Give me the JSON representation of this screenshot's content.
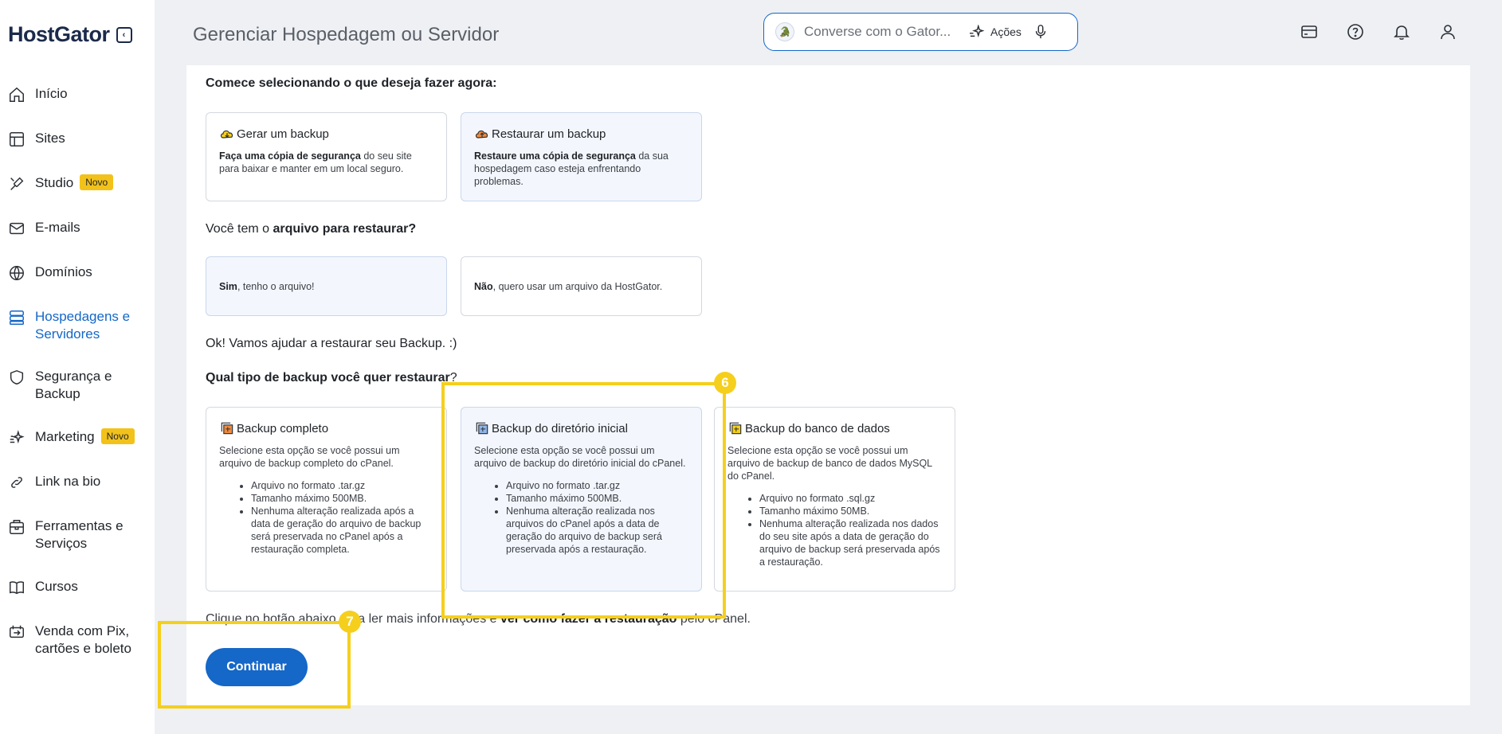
{
  "app": {
    "logo": "HostGator"
  },
  "sidebar": {
    "items": [
      {
        "label": "Início",
        "icon": "home-icon"
      },
      {
        "label": "Sites",
        "icon": "layout-icon"
      },
      {
        "label": "Studio",
        "icon": "brush-icon",
        "badge": "Novo"
      },
      {
        "label": "E-mails",
        "icon": "mail-icon"
      },
      {
        "label": "Domínios",
        "icon": "globe-icon"
      },
      {
        "label": "Hospedagens e Servidores",
        "icon": "server-icon",
        "active": true
      },
      {
        "label": "Segurança e Backup",
        "icon": "shield-icon"
      },
      {
        "label": "Marketing",
        "icon": "sparkle-icon",
        "badge": "Novo"
      },
      {
        "label": "Link na bio",
        "icon": "link-icon"
      },
      {
        "label": "Ferramentas e Serviços",
        "icon": "tools-icon"
      },
      {
        "label": "Cursos",
        "icon": "book-icon"
      },
      {
        "label": "Venda com Pix, cartões e boleto",
        "icon": "payment-icon"
      }
    ]
  },
  "header": {
    "title": "Gerenciar Hospedagem ou Servidor",
    "search_placeholder": "Converse com o Gator...",
    "actions_label": "Ações",
    "icons": [
      "card-icon",
      "help-icon",
      "bell-icon",
      "user-icon"
    ]
  },
  "main": {
    "step1": {
      "heading": "Comece selecionando o que deseja fazer agora:",
      "options": [
        {
          "title": "Gerar um backup",
          "desc_bold": "Faça uma cópia de segurança",
          "desc_rest": " do seu site para baixar e manter em um local seguro.",
          "icon": "cloud-backup-icon"
        },
        {
          "title": "Restaurar um backup",
          "desc_bold": "Restaure uma cópia de segurança",
          "desc_rest": " da sua hospedagem caso esteja enfrentando problemas.",
          "icon": "cloud-restore-icon",
          "selected": true
        }
      ]
    },
    "step2": {
      "heading_pre": "Você tem o ",
      "heading_bold": "arquivo para restaurar?",
      "options": [
        {
          "bold": "Sim",
          "rest": ", tenho o arquivo!",
          "selected": true
        },
        {
          "bold": "Não",
          "rest": ", quero usar um arquivo da HostGator."
        }
      ]
    },
    "ok_text": "Ok! Vamos ajudar a restaurar seu Backup. :)",
    "step3": {
      "heading_bold": "Qual tipo de backup você quer restaurar",
      "heading_rest": "?",
      "options": [
        {
          "title": "Backup completo",
          "desc": "Selecione esta opção se você possui um arquivo de backup completo do cPanel.",
          "bullets": [
            "Arquivo no formato .tar.gz",
            "Tamanho máximo 500MB.",
            "Nenhuma alteração realizada após a data de geração do arquivo de backup será preservada no cPanel após a restauração completa."
          ]
        },
        {
          "title": "Backup do diretório inicial",
          "desc": "Selecione esta opção se você possui um arquivo de backup do diretório inicial do cPanel.",
          "bullets": [
            "Arquivo no formato .tar.gz",
            "Tamanho máximo 500MB.",
            "Nenhuma alteração realizada nos arquivos do cPanel após a data de geração do arquivo de backup será preservada após a restauração."
          ],
          "selected": true
        },
        {
          "title": "Backup do banco de dados",
          "desc": "Selecione esta opção se você possui um arquivo de backup de banco de dados MySQL do cPanel.",
          "bullets": [
            "Arquivo no formato .sql.gz",
            "Tamanho máximo 50MB.",
            "Nenhuma alteração realizada nos dados do seu site após a data de geração do arquivo de backup será preservada após a restauração."
          ]
        }
      ]
    },
    "footer_pre": "Clique no botão abaixo para ler mais informações e ",
    "footer_link": "ver como fazer a restauração",
    "footer_post": " pelo cPanel.",
    "continue_label": "Continuar"
  },
  "annotations": {
    "step6": "6",
    "step7": "7",
    "color": "#f5cf1c"
  }
}
